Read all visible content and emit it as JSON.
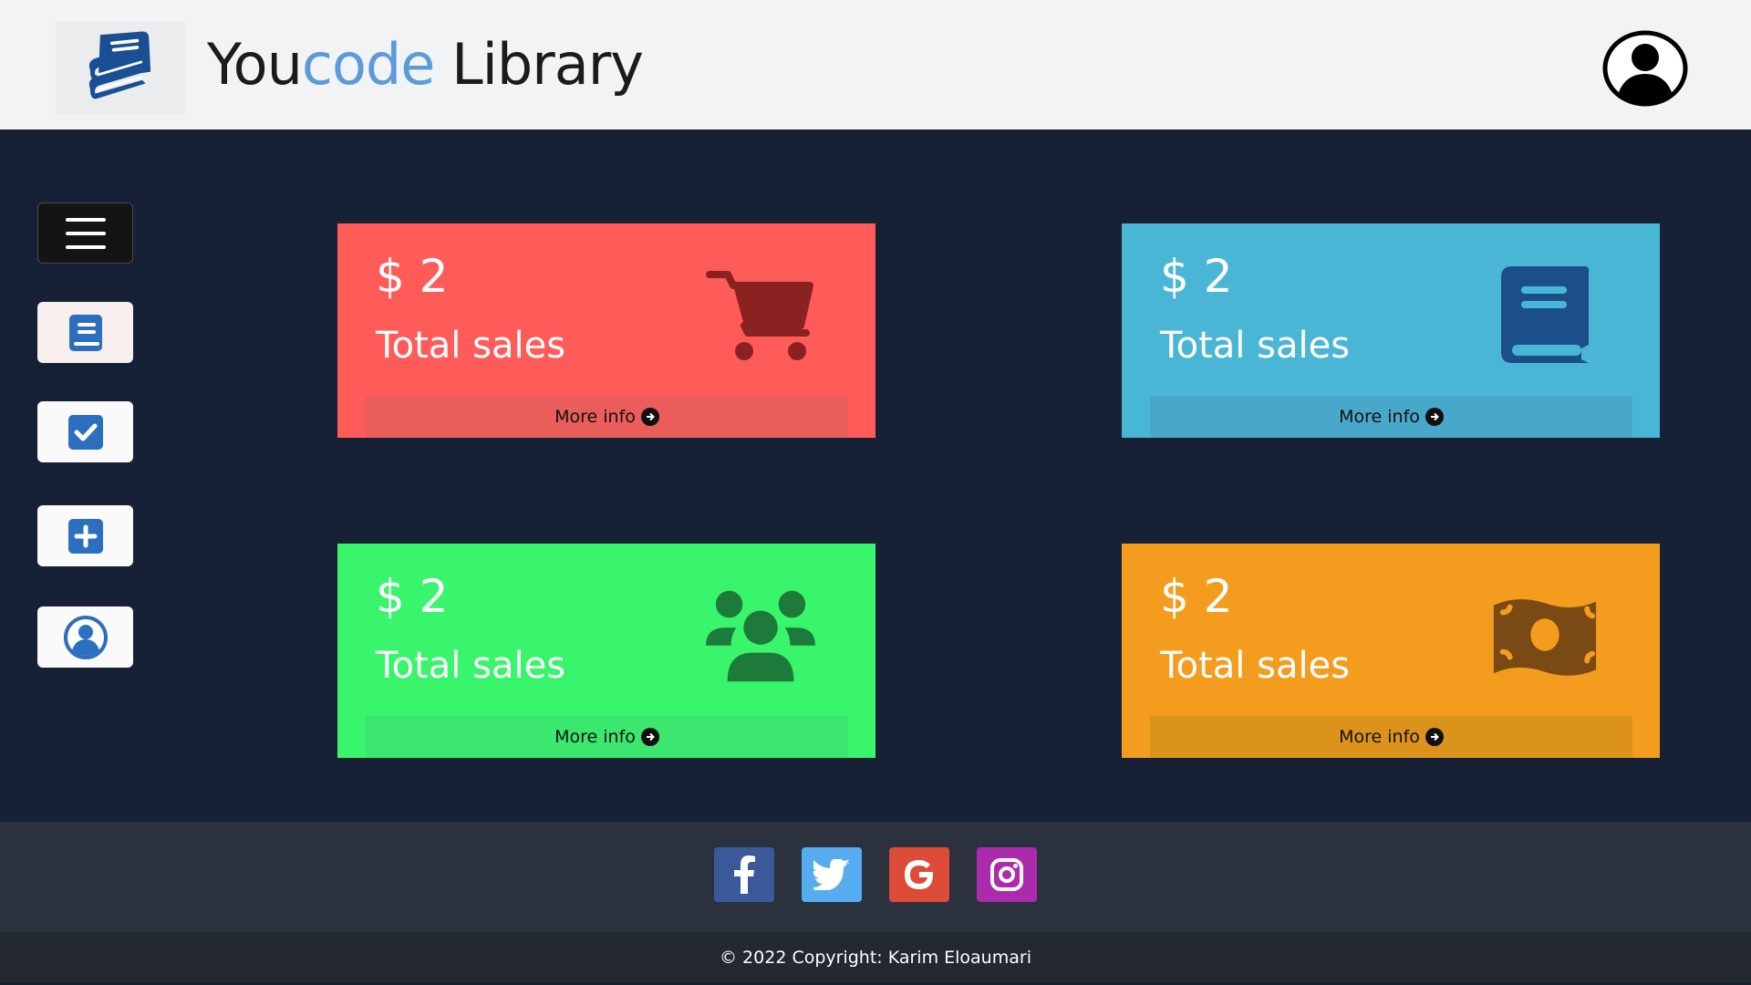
{
  "header": {
    "brand_part1": "You",
    "brand_accent": "code",
    "brand_part2": " Library",
    "logo_icon": "books-icon",
    "avatar_icon": "user-circle-icon"
  },
  "sidebar": {
    "items": [
      {
        "name": "menu",
        "icon": "hamburger-icon"
      },
      {
        "name": "books",
        "icon": "book-icon"
      },
      {
        "name": "tasks",
        "icon": "check-square-icon"
      },
      {
        "name": "add",
        "icon": "plus-square-icon"
      },
      {
        "name": "profile",
        "icon": "user-circle-icon"
      }
    ]
  },
  "cards": [
    {
      "value": "$ 2",
      "label": "Total sales",
      "more": "More info",
      "icon": "cart-icon",
      "color": "#ff5b59"
    },
    {
      "value": "$ 2",
      "label": "Total sales",
      "more": "More info",
      "icon": "book-icon",
      "color": "#4ab6d6"
    },
    {
      "value": "$ 2",
      "label": "Total sales",
      "more": "More info",
      "icon": "users-icon",
      "color": "#38f56b"
    },
    {
      "value": "$ 2",
      "label": "Total sales",
      "more": "More info",
      "icon": "money-icon",
      "color": "#f49c1d"
    }
  ],
  "footer": {
    "social": [
      "facebook-icon",
      "twitter-icon",
      "google-icon",
      "instagram-icon"
    ],
    "copyright": "© 2022 Copyright: Karim Eloaumari"
  },
  "colors": {
    "bg": "#172136",
    "accent": "#5b9bd9",
    "primary_icon": "#2c6fbf"
  }
}
